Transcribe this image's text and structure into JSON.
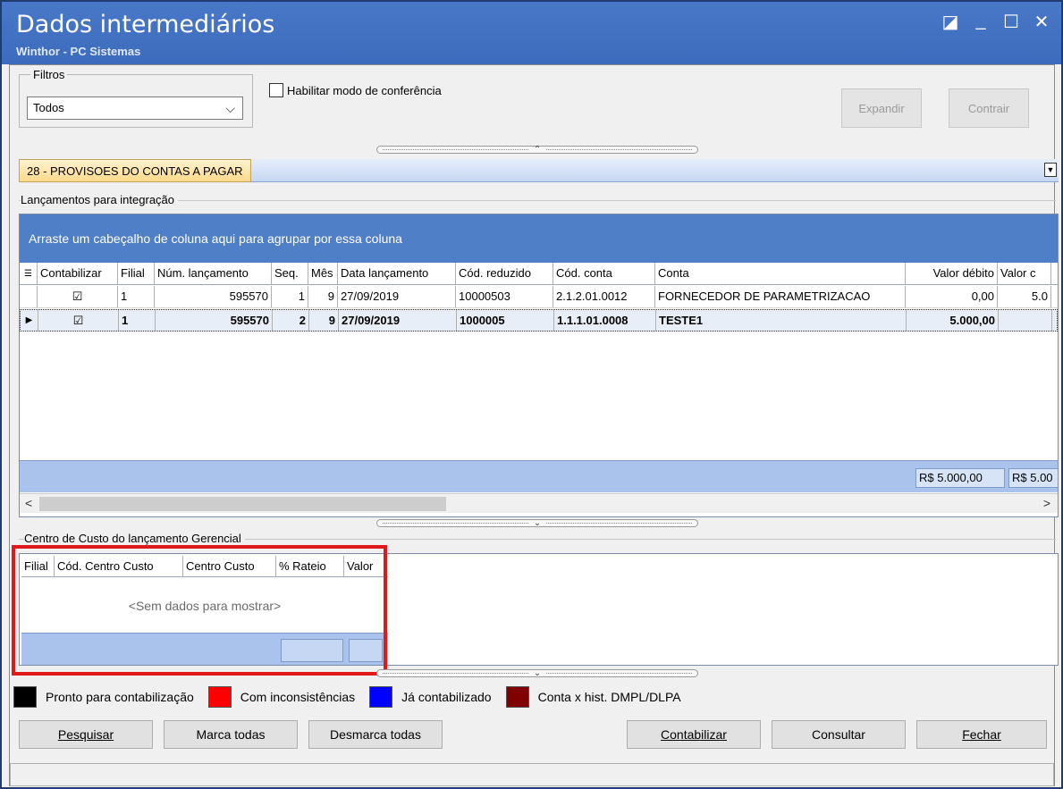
{
  "window": {
    "title": "Dados intermediários",
    "subtitle": "Winthor - PC Sistemas"
  },
  "filters": {
    "legend": "Filtros",
    "selected": "Todos",
    "mode_label": "Habilitar modo de conferência",
    "expand_label": "Expandir",
    "collapse_label": "Contrair"
  },
  "tab": {
    "label": "28 - PROVISOES DO CONTAS A PAGAR"
  },
  "launch_section": {
    "label": "Lançamentos para integração",
    "group_hint": "Arraste um cabeçalho de coluna aqui para agrupar por essa coluna",
    "columns": [
      "Contabilizar",
      "Filial",
      "Núm. lançamento",
      "Seq.",
      "Mês",
      "Data lançamento",
      "Cód. reduzido",
      "Cód. conta",
      "Conta",
      "Valor débito",
      "Valor c"
    ],
    "rows": [
      {
        "contabilizar": "☑",
        "filial": "1",
        "num": "595570",
        "seq": "1",
        "mes": "9",
        "data": "27/09/2019",
        "cod_reduzido": "10000503",
        "cod_conta": "2.1.2.01.0012",
        "conta": "FORNECEDOR DE PARAMETRIZACAO",
        "valor_debito": "0,00",
        "valor_credito": "5.0"
      },
      {
        "contabilizar": "☑",
        "filial": "1",
        "num": "595570",
        "seq": "2",
        "mes": "9",
        "data": "27/09/2019",
        "cod_reduzido": "1000005",
        "cod_conta": "1.1.1.01.0008",
        "conta": "TESTE1",
        "valor_debito": "5.000,00",
        "valor_credito": ""
      }
    ],
    "totals": {
      "debito": "R$ 5.000,00",
      "credito": "R$ 5.00"
    }
  },
  "cost_center": {
    "label": "Centro de Custo do lançamento Gerencial",
    "columns": [
      "Filial",
      "Cód. Centro Custo",
      "Centro Custo",
      "% Rateio",
      "Valor"
    ],
    "empty": "<Sem dados para mostrar>"
  },
  "legend": {
    "items": [
      {
        "label": "Pronto para contabilização",
        "color": "#000000"
      },
      {
        "label": "Com inconsistências",
        "color": "#ff0000"
      },
      {
        "label": "Já contabilizado",
        "color": "#0000ff"
      },
      {
        "label": "Conta x hist. DMPL/DLPA",
        "color": "#800000"
      }
    ]
  },
  "buttons": {
    "search": "Pesquisar",
    "mark_all": "Marca todas",
    "unmark_all": "Desmarca todas",
    "post": "Contabilizar",
    "query": "Consultar",
    "close": "Fechar"
  }
}
